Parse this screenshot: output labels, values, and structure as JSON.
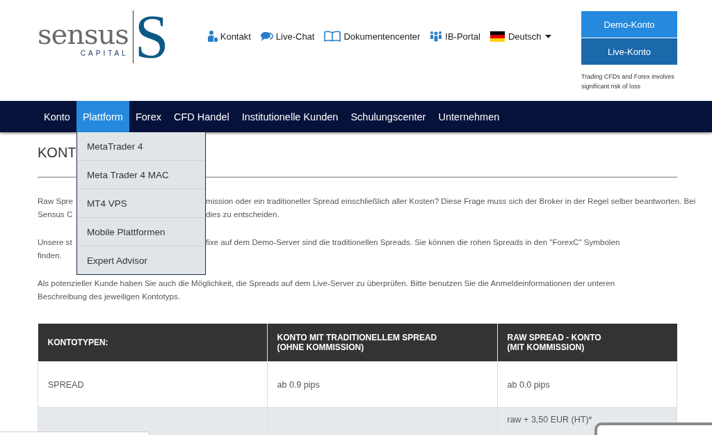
{
  "logo": {
    "word": "sensus",
    "sub": "CAPITAL",
    "letter": "S"
  },
  "top_links": [
    {
      "label": "Kontakt"
    },
    {
      "label": "Live-Chat"
    },
    {
      "label": "Dokumentencenter"
    },
    {
      "label": "IB-Portal"
    }
  ],
  "language": {
    "label": "Deutsch"
  },
  "account_buttons": [
    {
      "label": "Demo-Konto",
      "kind": "demo"
    },
    {
      "label": "Live-Konto",
      "kind": "live"
    }
  ],
  "risk_note": "Trading CFDs and Forex involves significant risk of loss",
  "nav": [
    {
      "label": "Konto",
      "selected": false
    },
    {
      "label": "Plattform",
      "selected": true
    },
    {
      "label": "Forex",
      "selected": false
    },
    {
      "label": "CFD Handel",
      "selected": false
    },
    {
      "label": "Institutionelle Kunden",
      "selected": false
    },
    {
      "label": "Schulungscenter",
      "selected": false
    },
    {
      "label": "Unternehmen",
      "selected": false
    }
  ],
  "dropdown": [
    "MetaTrader 4",
    "Meta Trader 4 MAC",
    "MT4 VPS",
    "Mobile Plattformen",
    "Expert Advisor"
  ],
  "heading": "KONT",
  "paragraphs": [
    [
      {
        "left": "Raw Spre",
        "right": "mission oder ein traditioneller Spread einschließlich aller Kosten? Diese Frage muss sich der Broker in der Regel selber beantworten. Bei"
      },
      {
        "left": "Sensus C",
        "right": "dies zu entscheiden."
      }
    ],
    [
      {
        "left": "Unsere st",
        "right": "fixe auf dem Demo-Server sind die traditionellen Spreads. Sie können die rohen Spreads in den \"ForexC\" Symbolen"
      },
      {
        "left": "finden."
      }
    ],
    [
      {
        "left": "Als potenzieller Kunde haben Sie auch die Möglichkeit, die Spreads auf dem Live-Server zu überprüfen. Bitte benutzen Sie die Anmeldeinformationen der unteren"
      },
      {
        "left": "Beschreibung des jeweiligen Kontotyps."
      }
    ]
  ],
  "table": {
    "columns": [
      [
        "KONTOTYPEN:"
      ],
      [
        "KONTO MIT TRADITIONELLEM SPREAD",
        "(OHNE KOMMISSION)"
      ],
      [
        "RAW SPREAD - KONTO",
        "(MIT KOMMISSION)"
      ]
    ],
    "rows": [
      {
        "column_1": "SPREAD",
        "column_2": "ab 0.9 pips",
        "column_3": "ab 0.0 pips"
      },
      {
        "column_3": "raw + 3,50 EUR (HT)*"
      }
    ]
  }
}
